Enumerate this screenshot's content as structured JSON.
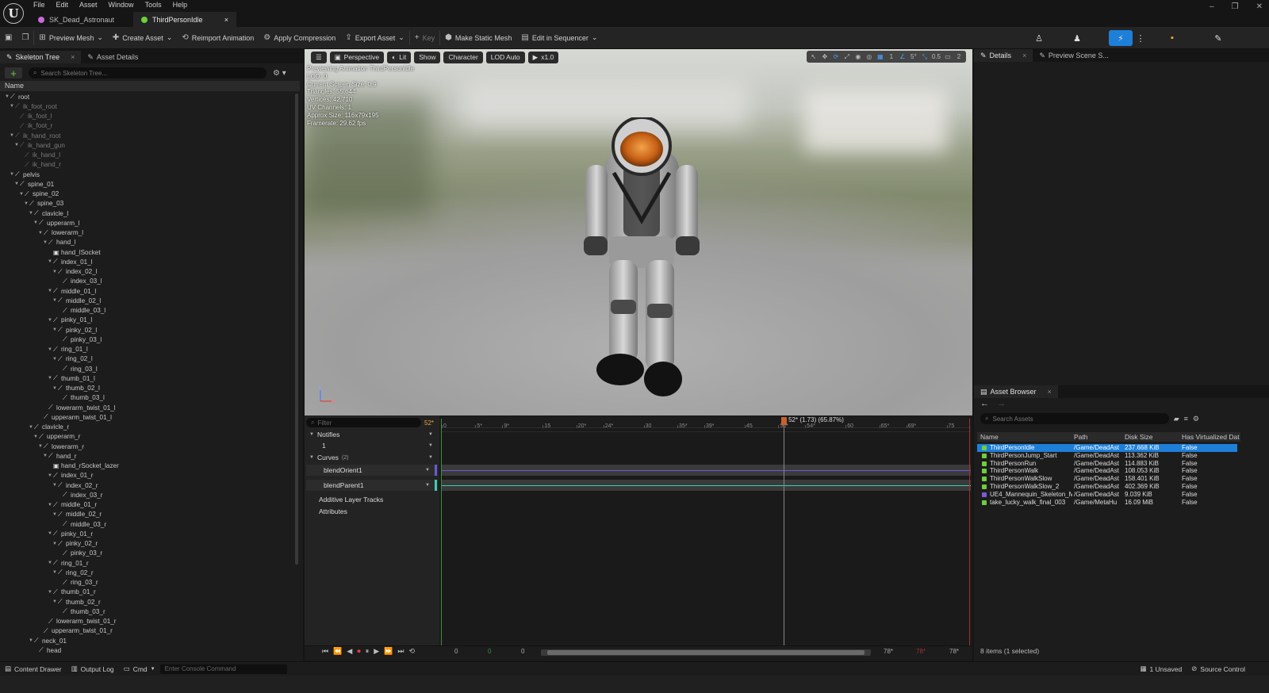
{
  "app": {
    "logo": "U",
    "menu": [
      "File",
      "Edit",
      "Asset",
      "Window",
      "Tools",
      "Help"
    ],
    "doc_tabs": [
      {
        "label": "SK_Dead_Astronaut",
        "color": "#c86ad8",
        "active": false
      },
      {
        "label": "ThirdPersonIdle",
        "color": "#6ecf3a",
        "active": true
      }
    ],
    "tab_close": "×",
    "window_controls": [
      "–",
      "❐",
      "✕"
    ]
  },
  "toolbar": {
    "items": [
      {
        "label": "Preview Mesh",
        "icon": "⊞",
        "dropdown": true
      },
      {
        "label": "Create Asset",
        "icon": "✚",
        "dropdown": true
      },
      {
        "label": "Reimport Animation",
        "icon": "⟲",
        "dropdown": false
      },
      {
        "label": "Apply Compression",
        "icon": "⚙",
        "dropdown": false
      },
      {
        "label": "Export Asset",
        "icon": "⇪",
        "dropdown": true
      },
      {
        "label": "Key",
        "icon": "+",
        "dropdown": false,
        "disabled": true
      },
      {
        "label": "Make Static Mesh",
        "icon": "⬢",
        "dropdown": false
      },
      {
        "label": "Edit in Sequencer",
        "icon": "▤",
        "dropdown": true
      }
    ],
    "mode_buttons": [
      {
        "icon": "♙",
        "color": "#242424"
      },
      {
        "icon": "♟",
        "color": "#242424"
      },
      {
        "icon": "⚡",
        "color": "#1e7fd8"
      },
      {
        "icon": "⋮",
        "color": "#242424"
      },
      {
        "icon": "▪",
        "color": "#242424"
      },
      {
        "icon": "✎",
        "color": "#242424"
      }
    ]
  },
  "skeleton_panel": {
    "tabs": [
      {
        "label": "Skeleton Tree",
        "active": true
      },
      {
        "label": "Asset Details",
        "active": false
      }
    ],
    "search_placeholder": "Search Skeleton Tree...",
    "add_label": "+",
    "column_header": "Name",
    "bones": [
      {
        "name": "root",
        "depth": 0,
        "dim": false,
        "arrow": true
      },
      {
        "name": "ik_foot_root",
        "depth": 1,
        "dim": true,
        "arrow": true
      },
      {
        "name": "ik_foot_l",
        "depth": 2,
        "dim": true,
        "arrow": false
      },
      {
        "name": "ik_foot_r",
        "depth": 2,
        "dim": true,
        "arrow": false
      },
      {
        "name": "ik_hand_root",
        "depth": 1,
        "dim": true,
        "arrow": true
      },
      {
        "name": "ik_hand_gun",
        "depth": 2,
        "dim": true,
        "arrow": true
      },
      {
        "name": "ik_hand_l",
        "depth": 3,
        "dim": true,
        "arrow": false
      },
      {
        "name": "ik_hand_r",
        "depth": 3,
        "dim": true,
        "arrow": false
      },
      {
        "name": "pelvis",
        "depth": 1,
        "dim": false,
        "arrow": true
      },
      {
        "name": "spine_01",
        "depth": 2,
        "dim": false,
        "arrow": true
      },
      {
        "name": "spine_02",
        "depth": 3,
        "dim": false,
        "arrow": true
      },
      {
        "name": "spine_03",
        "depth": 4,
        "dim": false,
        "arrow": true
      },
      {
        "name": "clavicle_l",
        "depth": 5,
        "dim": false,
        "arrow": true
      },
      {
        "name": "upperarm_l",
        "depth": 6,
        "dim": false,
        "arrow": true
      },
      {
        "name": "lowerarm_l",
        "depth": 7,
        "dim": false,
        "arrow": true
      },
      {
        "name": "hand_l",
        "depth": 8,
        "dim": false,
        "arrow": true
      },
      {
        "name": "hand_lSocket",
        "depth": 9,
        "dim": false,
        "arrow": false,
        "socket": true
      },
      {
        "name": "index_01_l",
        "depth": 9,
        "dim": false,
        "arrow": true
      },
      {
        "name": "index_02_l",
        "depth": 10,
        "dim": false,
        "arrow": true
      },
      {
        "name": "index_03_l",
        "depth": 11,
        "dim": false,
        "arrow": false
      },
      {
        "name": "middle_01_l",
        "depth": 9,
        "dim": false,
        "arrow": true
      },
      {
        "name": "middle_02_l",
        "depth": 10,
        "dim": false,
        "arrow": true
      },
      {
        "name": "middle_03_l",
        "depth": 11,
        "dim": false,
        "arrow": false
      },
      {
        "name": "pinky_01_l",
        "depth": 9,
        "dim": false,
        "arrow": true
      },
      {
        "name": "pinky_02_l",
        "depth": 10,
        "dim": false,
        "arrow": true
      },
      {
        "name": "pinky_03_l",
        "depth": 11,
        "dim": false,
        "arrow": false
      },
      {
        "name": "ring_01_l",
        "depth": 9,
        "dim": false,
        "arrow": true
      },
      {
        "name": "ring_02_l",
        "depth": 10,
        "dim": false,
        "arrow": true
      },
      {
        "name": "ring_03_l",
        "depth": 11,
        "dim": false,
        "arrow": false
      },
      {
        "name": "thumb_01_l",
        "depth": 9,
        "dim": false,
        "arrow": true
      },
      {
        "name": "thumb_02_l",
        "depth": 10,
        "dim": false,
        "arrow": true
      },
      {
        "name": "thumb_03_l",
        "depth": 11,
        "dim": false,
        "arrow": false
      },
      {
        "name": "lowerarm_twist_01_l",
        "depth": 8,
        "dim": false,
        "arrow": false
      },
      {
        "name": "upperarm_twist_01_l",
        "depth": 7,
        "dim": false,
        "arrow": false
      },
      {
        "name": "clavicle_r",
        "depth": 5,
        "dim": false,
        "arrow": true
      },
      {
        "name": "upperarm_r",
        "depth": 6,
        "dim": false,
        "arrow": true
      },
      {
        "name": "lowerarm_r",
        "depth": 7,
        "dim": false,
        "arrow": true
      },
      {
        "name": "hand_r",
        "depth": 8,
        "dim": false,
        "arrow": true
      },
      {
        "name": "hand_rSocket_lazer",
        "depth": 9,
        "dim": false,
        "arrow": false,
        "socket": true
      },
      {
        "name": "index_01_r",
        "depth": 9,
        "dim": false,
        "arrow": true
      },
      {
        "name": "index_02_r",
        "depth": 10,
        "dim": false,
        "arrow": true
      },
      {
        "name": "index_03_r",
        "depth": 11,
        "dim": false,
        "arrow": false
      },
      {
        "name": "middle_01_r",
        "depth": 9,
        "dim": false,
        "arrow": true
      },
      {
        "name": "middle_02_r",
        "depth": 10,
        "dim": false,
        "arrow": true
      },
      {
        "name": "middle_03_r",
        "depth": 11,
        "dim": false,
        "arrow": false
      },
      {
        "name": "pinky_01_r",
        "depth": 9,
        "dim": false,
        "arrow": true
      },
      {
        "name": "pinky_02_r",
        "depth": 10,
        "dim": false,
        "arrow": true
      },
      {
        "name": "pinky_03_r",
        "depth": 11,
        "dim": false,
        "arrow": false
      },
      {
        "name": "ring_01_r",
        "depth": 9,
        "dim": false,
        "arrow": true
      },
      {
        "name": "ring_02_r",
        "depth": 10,
        "dim": false,
        "arrow": true
      },
      {
        "name": "ring_03_r",
        "depth": 11,
        "dim": false,
        "arrow": false
      },
      {
        "name": "thumb_01_r",
        "depth": 9,
        "dim": false,
        "arrow": true
      },
      {
        "name": "thumb_02_r",
        "depth": 10,
        "dim": false,
        "arrow": true
      },
      {
        "name": "thumb_03_r",
        "depth": 11,
        "dim": false,
        "arrow": false
      },
      {
        "name": "lowerarm_twist_01_r",
        "depth": 8,
        "dim": false,
        "arrow": false
      },
      {
        "name": "upperarm_twist_01_r",
        "depth": 7,
        "dim": false,
        "arrow": false
      },
      {
        "name": "neck_01",
        "depth": 5,
        "dim": false,
        "arrow": true
      },
      {
        "name": "head",
        "depth": 6,
        "dim": false,
        "arrow": false
      }
    ]
  },
  "viewport": {
    "buttons": [
      {
        "label": "",
        "icon": "☰"
      },
      {
        "label": "Perspective",
        "icon": "▣"
      },
      {
        "label": "Lit",
        "icon": "◐"
      },
      {
        "label": "Show",
        "icon": ""
      },
      {
        "label": "Character",
        "icon": ""
      },
      {
        "label": "LOD Auto",
        "icon": ""
      },
      {
        "label": "x1.0",
        "icon": "▶"
      }
    ],
    "right_tools": [
      "↖",
      "✥",
      "⟳",
      "⤢",
      "◉",
      "◎",
      "▦",
      "1",
      "∠",
      "5°",
      "⤡",
      "0.5",
      "▭",
      "2"
    ],
    "info_lines": [
      "Previewing Animation ThirdPersonIdle",
      "LOD: 0",
      "Current Screen Size: 0.9",
      "Triangles: 55,644",
      "Vertices: 42,710",
      "UV Channels: 1",
      "Approx Size: 116x79x195",
      "Framerate: 29.62 fps"
    ],
    "axis": {
      "z": "Z",
      "x": "X"
    }
  },
  "timeline": {
    "filter_placeholder": "Filter",
    "current_frame": "52*",
    "playhead_label": "52* (1.73) (65.87%)",
    "playhead_fraction": 0.6587,
    "ticks": [
      "0",
      "5*",
      "9*",
      "15",
      "20*",
      "24*",
      "30",
      "35*",
      "39*",
      "45",
      "50*",
      "54*",
      "60",
      "65*",
      "69*",
      "75"
    ],
    "tracks": {
      "notifies": "Notifies",
      "notify_track": "1",
      "curves": "Curves",
      "curves_count": "(2)",
      "curve1": "blendOrient1",
      "curve2": "blendParent1",
      "additive": "Additive Layer Tracks",
      "attributes": "Attributes"
    },
    "transport": {
      "start": "0",
      "mid_green": "0",
      "mid": "0",
      "end1": "78*",
      "end_red": "78*",
      "end2": "78*",
      "icons": [
        "⏮",
        "⏪",
        "◀",
        "⏺",
        "⏸",
        "▶",
        "⏩",
        "⏭",
        "⟲"
      ]
    }
  },
  "details_panel": {
    "tabs": [
      {
        "label": "Details",
        "active": true
      },
      {
        "label": "Preview Scene S...",
        "active": false
      }
    ]
  },
  "asset_browser": {
    "tab": "Asset Browser",
    "search_placeholder": "Search Assets",
    "columns": [
      "Name",
      "Path",
      "Disk Size",
      "Has Virtualized Dat"
    ],
    "rows": [
      {
        "name": "ThirdPersonIdle",
        "path": "/Game/DeadAst",
        "size": "237.668 KiB",
        "virt": "False",
        "selected": true,
        "color": "#6ecf3a"
      },
      {
        "name": "ThirdPersonJump_Start",
        "path": "/Game/DeadAst",
        "size": "113.362 KiB",
        "virt": "False",
        "selected": false,
        "color": "#6ecf3a"
      },
      {
        "name": "ThirdPersonRun",
        "path": "/Game/DeadAst",
        "size": "114.883 KiB",
        "virt": "False",
        "selected": false,
        "color": "#6ecf3a"
      },
      {
        "name": "ThirdPersonWalk",
        "path": "/Game/DeadAst",
        "size": "108.053 KiB",
        "virt": "False",
        "selected": false,
        "color": "#6ecf3a"
      },
      {
        "name": "ThirdPersonWalkSlow",
        "path": "/Game/DeadAst",
        "size": "158.401 KiB",
        "virt": "False",
        "selected": false,
        "color": "#6ecf3a"
      },
      {
        "name": "ThirdPersonWalkSlow_2",
        "path": "/Game/DeadAst",
        "size": "402.369 KiB",
        "virt": "False",
        "selected": false,
        "color": "#6ecf3a"
      },
      {
        "name": "UE4_Mannequin_Skeleton_M",
        "path": "/Game/DeadAst",
        "size": "9.039 KiB",
        "virt": "False",
        "selected": false,
        "color": "#7a5ad8"
      },
      {
        "name": "take_lucky_walk_final_003",
        "path": "/Game/MetaHu",
        "size": "16.09 MiB",
        "virt": "False",
        "selected": false,
        "color": "#6ecf3a"
      }
    ],
    "count": "8 items (1 selected)"
  },
  "statusbar": {
    "content_drawer": "Content Drawer",
    "output_log": "Output Log",
    "cmd": "Cmd",
    "console_placeholder": "Enter Console Command",
    "unsaved": "1 Unsaved",
    "source_control": "Source Control"
  }
}
